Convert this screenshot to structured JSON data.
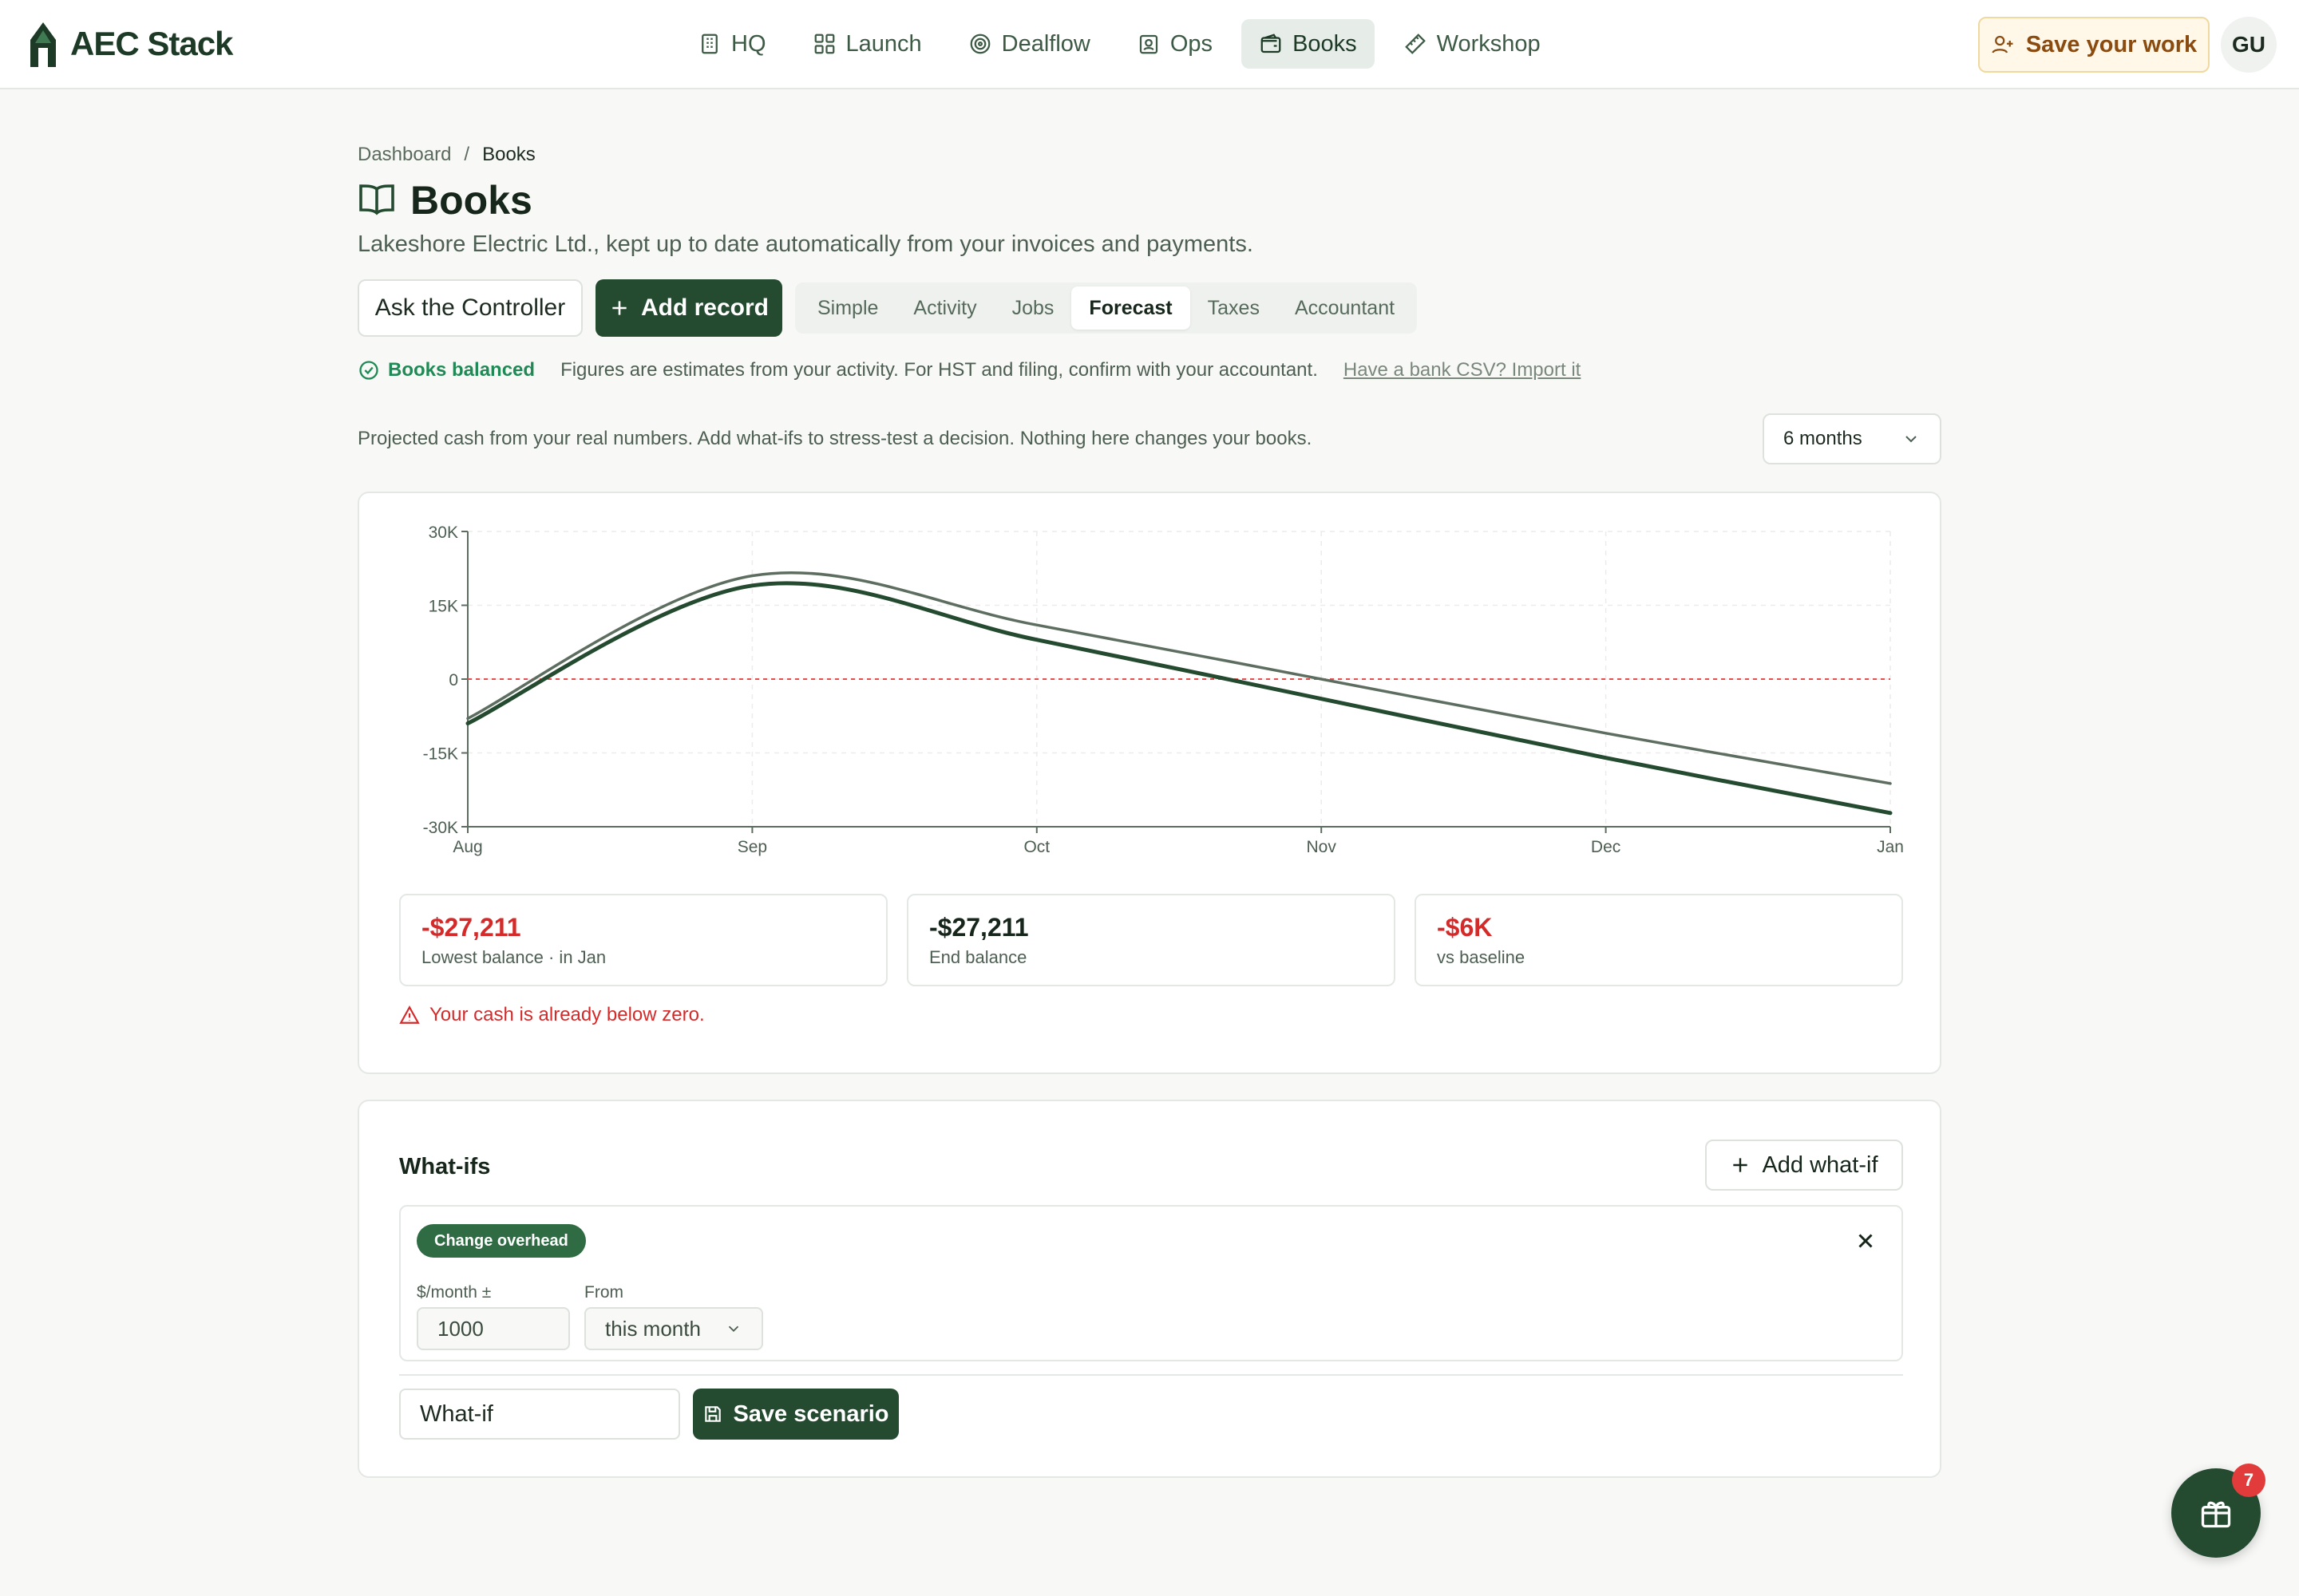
{
  "app": {
    "brand": "AEC Stack",
    "nav": [
      {
        "label": "HQ",
        "icon": "building-icon"
      },
      {
        "label": "Launch",
        "icon": "grid-icon"
      },
      {
        "label": "Dealflow",
        "icon": "target-icon"
      },
      {
        "label": "Ops",
        "icon": "badge-icon"
      },
      {
        "label": "Books",
        "icon": "wallet-icon"
      },
      {
        "label": "Workshop",
        "icon": "ruler-icon"
      }
    ],
    "active_nav": "Books",
    "save_work": "Save your work",
    "user_initials": "GU"
  },
  "page": {
    "breadcrumb": {
      "parent": "Dashboard",
      "separator": "/",
      "current": "Books"
    },
    "title": "Books",
    "subtitle": "Lakeshore Electric Ltd., kept up to date automatically from your invoices and payments.",
    "ask_button": "Ask the Controller",
    "add_button": "Add record",
    "tabs": [
      "Simple",
      "Activity",
      "Jobs",
      "Forecast",
      "Taxes",
      "Accountant"
    ],
    "active_tab": "Forecast",
    "status": {
      "balanced": "Books balanced",
      "note": "Figures are estimates from your activity. For HST and filing, confirm with your accountant.",
      "import_link": "Have a bank CSV? Import it"
    },
    "intro": "Projected cash from your real numbers. Add what-ifs to stress-test a decision. Nothing here changes your books.",
    "horizon": "6 months"
  },
  "chart_data": {
    "type": "line",
    "x": [
      "Aug",
      "Sep",
      "Oct",
      "Nov",
      "Dec",
      "Jan"
    ],
    "yticks": [
      "30K",
      "15K",
      "0",
      "-15K",
      "-30K"
    ],
    "ylim": [
      -30000,
      30000
    ],
    "zero_line_color": "#e05050",
    "grid": true,
    "series": [
      {
        "values": [
          -8000,
          21000,
          11000,
          0,
          -11000,
          -21211
        ],
        "color": "#5d6e60"
      },
      {
        "values": [
          -9000,
          19000,
          8000,
          -4000,
          -16000,
          -27211
        ],
        "color": "#244a30"
      }
    ]
  },
  "stats": [
    {
      "value": "-$27,211",
      "label": "Lowest balance · in Jan",
      "negative": true
    },
    {
      "value": "-$27,211",
      "label": "End balance",
      "negative": false
    },
    {
      "value": "-$6K",
      "label": "vs baseline",
      "negative": true
    }
  ],
  "warning": "Your cash is already below zero.",
  "whatifs": {
    "title": "What-ifs",
    "add_button": "Add what-if",
    "item": {
      "tag": "Change overhead",
      "amount_label": "$/month ±",
      "amount_value": "1000",
      "from_label": "From",
      "from_value": "this month"
    },
    "name_value": "What-if",
    "save_button": "Save scenario"
  },
  "fab": {
    "icon": "gift-icon",
    "badge": "7"
  },
  "colors": {
    "brand": "#244a30",
    "negative": "#d42a2a",
    "positive": "#1f8a55",
    "accent_warn": "#8a4b10"
  }
}
